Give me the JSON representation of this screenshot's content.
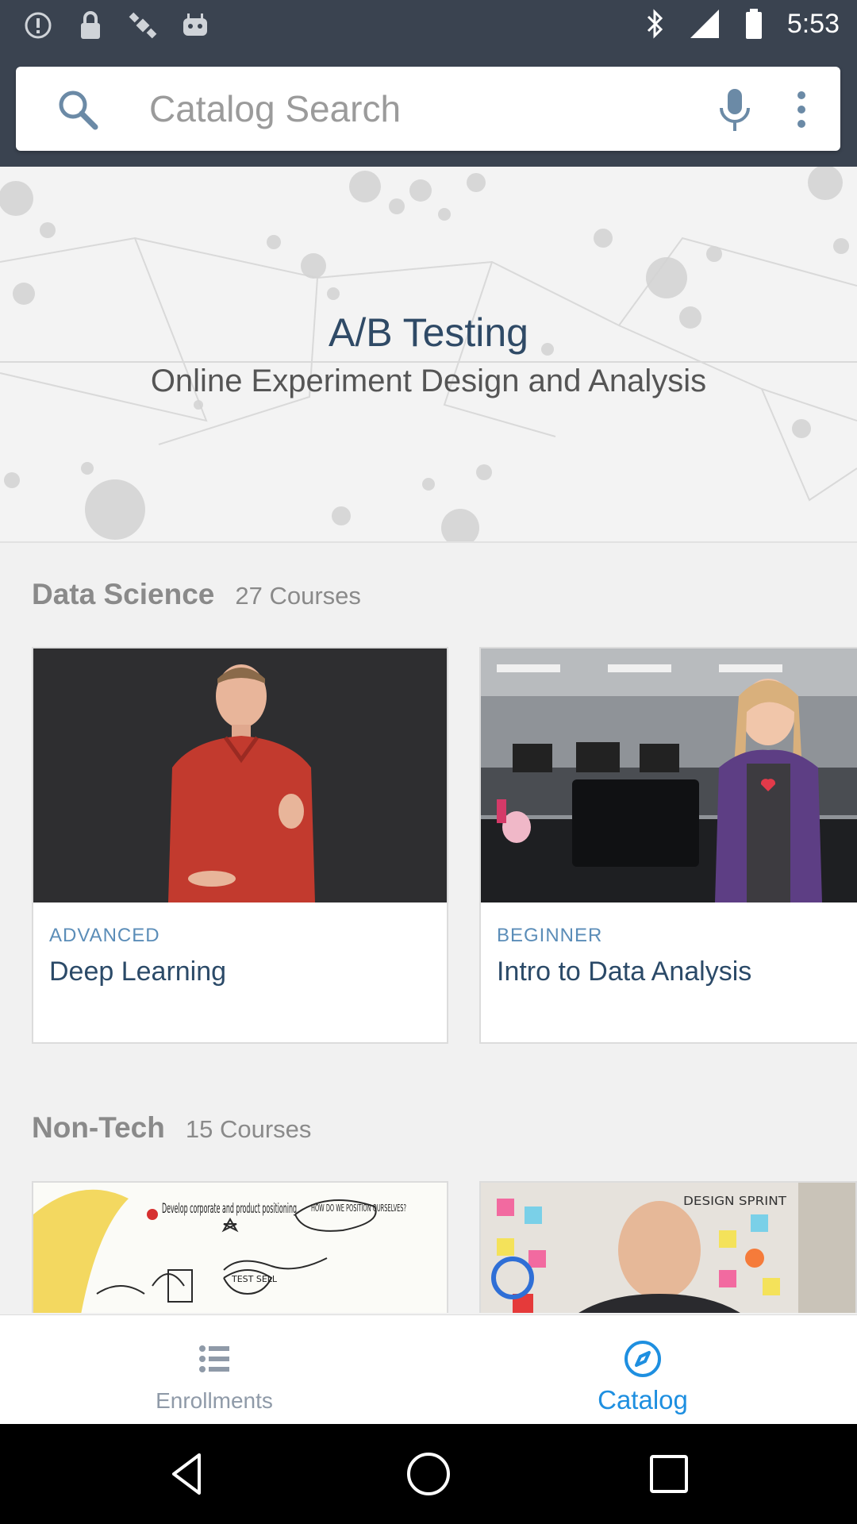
{
  "status_bar": {
    "time": "5:53",
    "icons": [
      "alert-icon",
      "lock-icon",
      "satellite-icon",
      "robot-icon",
      "bluetooth-icon",
      "signal-icon",
      "battery-icon"
    ]
  },
  "search": {
    "placeholder": "Catalog Search",
    "value": ""
  },
  "hero": {
    "title": "A/B Testing",
    "subtitle": "Online Experiment Design and Analysis"
  },
  "sections": [
    {
      "name": "Data Science",
      "count": "27 Courses",
      "courses": [
        {
          "level": "ADVANCED",
          "title": "Deep Learning"
        },
        {
          "level": "BEGINNER",
          "title": "Intro to Data Analysis"
        }
      ]
    },
    {
      "name": "Non-Tech",
      "count": "15 Courses",
      "thumb_texts": [
        "Develop corporate and product positioning",
        "HOW DO WE POSITION OURSELVES?",
        "TEST SELL",
        "DESIGN SPRINT"
      ]
    }
  ],
  "bottom_nav": {
    "items": [
      {
        "label": "Enrollments",
        "icon": "list-icon",
        "active": false
      },
      {
        "label": "Catalog",
        "icon": "compass-icon",
        "active": true
      }
    ]
  },
  "colors": {
    "header": "#3a4350",
    "accent": "#1e8fe0",
    "course_title": "#2b4a68",
    "level_text": "#5b8db8"
  }
}
